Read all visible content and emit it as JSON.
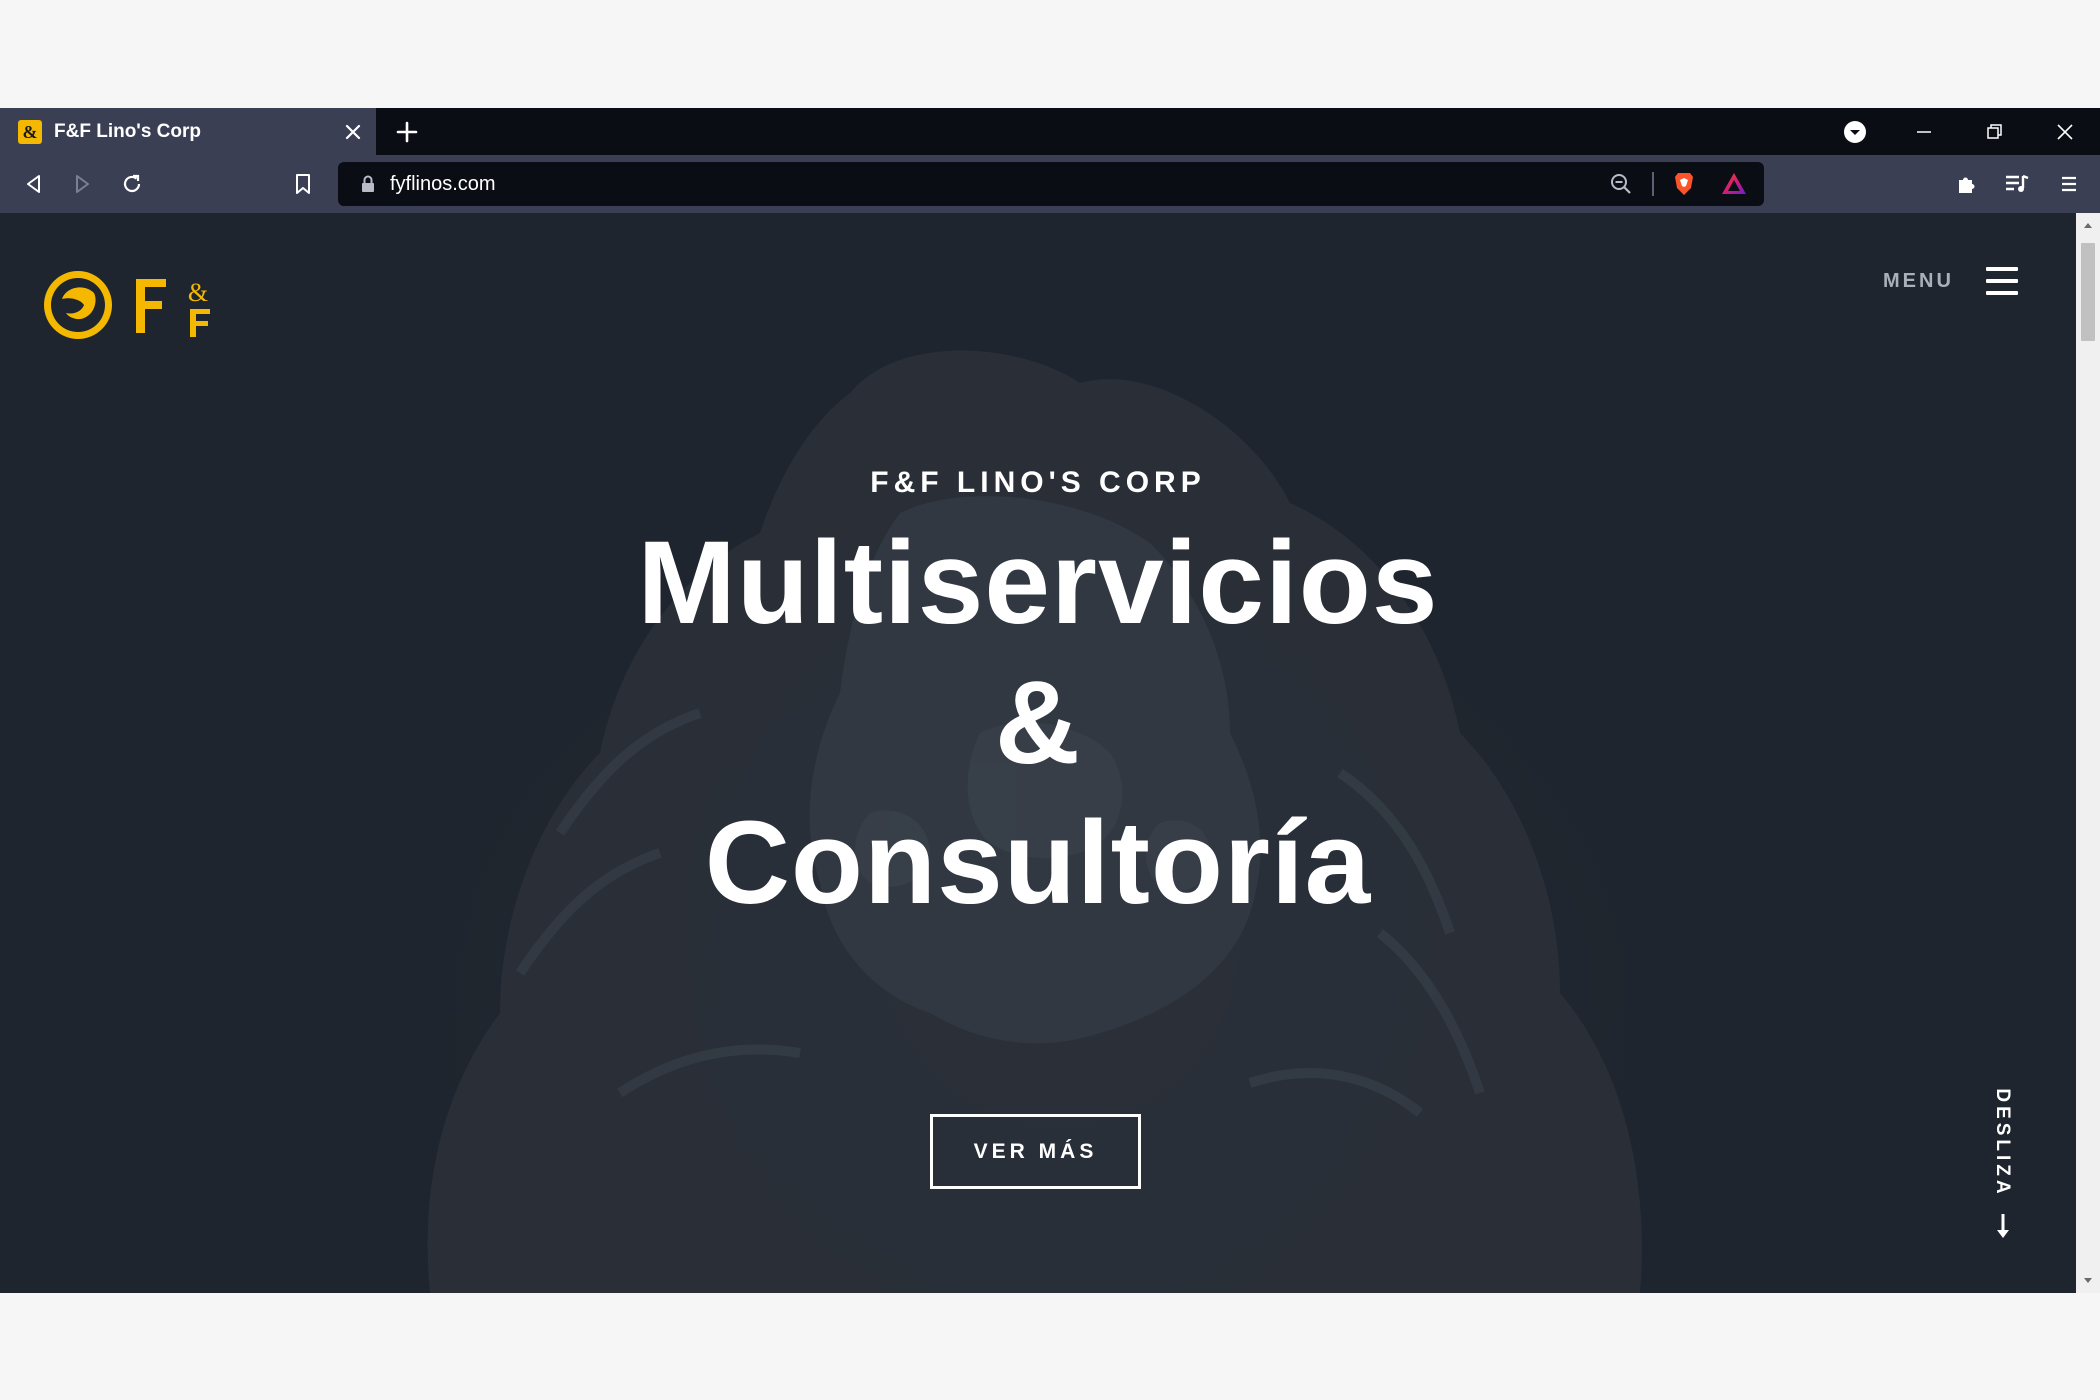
{
  "browser": {
    "tab_title": "F&F Lino's Corp",
    "favicon_text": "&",
    "url": "fyflinos.com",
    "colors": {
      "tab_active": "#3a3f54",
      "tabstrip": "#0b0d14",
      "urlbar": "#0b0d14"
    },
    "icons": [
      "back-icon",
      "forward-icon",
      "reload-icon",
      "bookmark-icon",
      "lock-icon",
      "zoom-out-icon",
      "brave-shield-icon",
      "brave-rewards-icon",
      "extensions-icon",
      "media-queue-icon",
      "menu-icon",
      "minimize-icon",
      "restore-icon",
      "close-icon",
      "new-tab-icon",
      "profile-dropdown-icon"
    ]
  },
  "page": {
    "nav": {
      "menu_label": "MENU"
    },
    "hero": {
      "eyebrow": "F&F LINO'S CORP",
      "headline_line1": "Multiservicios",
      "headline_line2": "&",
      "headline_line3": "Consultoría",
      "cta_label": "VER MÁS",
      "scroll_label": "DESLIZA"
    },
    "colors": {
      "brand_gold": "#f5b800",
      "hero_background": "#1f252e",
      "text": "#ffffff"
    }
  }
}
